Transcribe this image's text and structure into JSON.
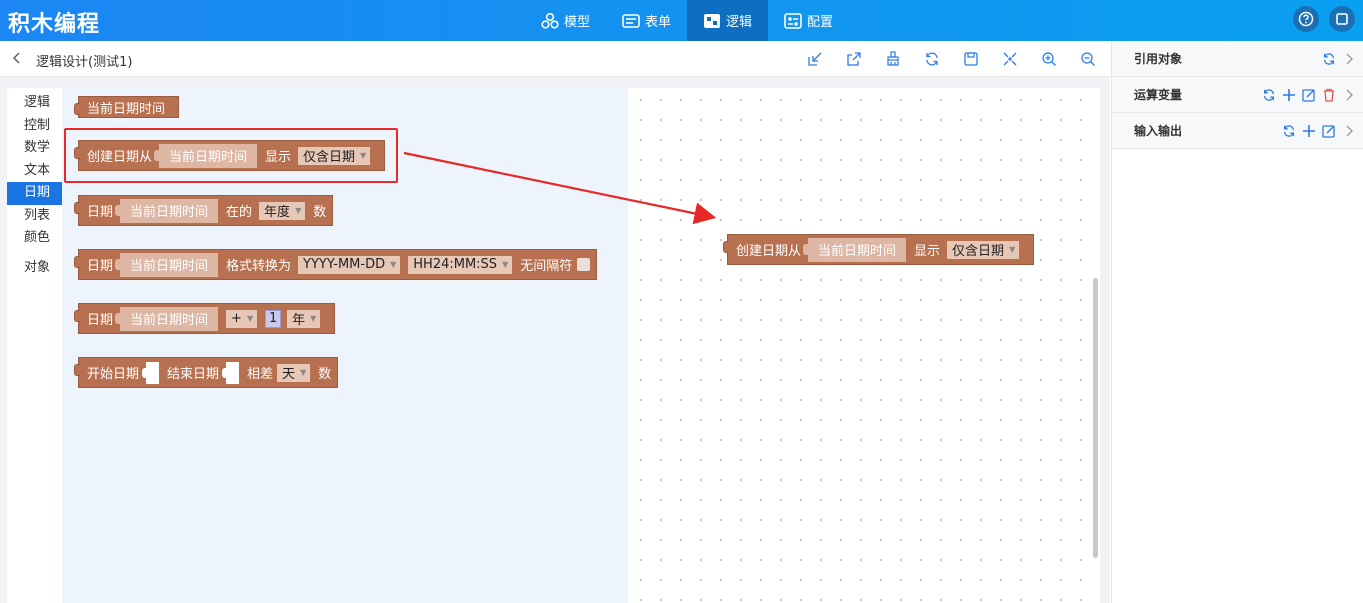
{
  "app": {
    "title": "积木编程"
  },
  "nav": [
    {
      "label": "模型",
      "icon": "cubes-icon",
      "active": false
    },
    {
      "label": "表单",
      "icon": "form-icon",
      "active": false
    },
    {
      "label": "逻辑",
      "icon": "logic-icon",
      "active": true
    },
    {
      "label": "配置",
      "icon": "config-icon",
      "active": false
    }
  ],
  "header_actions": [
    {
      "icon": "help-icon"
    },
    {
      "icon": "window-icon"
    }
  ],
  "subbar": {
    "title": "逻辑设计(测试1)"
  },
  "toolbar": [
    {
      "icon": "import-icon"
    },
    {
      "icon": "export-icon"
    },
    {
      "icon": "clean-icon"
    },
    {
      "icon": "refresh-icon"
    },
    {
      "icon": "save-icon"
    },
    {
      "icon": "center-icon"
    },
    {
      "icon": "zoom-in-icon"
    },
    {
      "icon": "zoom-out-icon"
    }
  ],
  "categories": [
    "逻辑",
    "控制",
    "数学",
    "文本",
    "日期",
    "列表",
    "颜色",
    "对象"
  ],
  "active_category": "日期",
  "blocks": {
    "b1": {
      "label": "当前日期时间"
    },
    "b2": {
      "label": "创建日期从",
      "inner": "当前日期时间",
      "show": "显示",
      "dd": "仅含日期"
    },
    "b3": {
      "label": "日期",
      "inner": "当前日期时间",
      "of": "在的",
      "dd": "年度",
      "tail": "数"
    },
    "b4": {
      "label": "日期",
      "inner": "当前日期时间",
      "fmt": "格式转换为",
      "dd1": "YYYY-MM-DD",
      "dd2": "HH24:MM:SS",
      "sep": "无间隔符"
    },
    "b5": {
      "label": "日期",
      "inner": "当前日期时间",
      "op": "+",
      "num": "1",
      "unit": "年"
    },
    "b6": {
      "label": "开始日期",
      "end": "结束日期",
      "diff": "相差",
      "dd": "天",
      "tail": "数"
    }
  },
  "canvas_block": {
    "label": "创建日期从",
    "inner": "当前日期时间",
    "show": "显示",
    "dd": "仅含日期"
  },
  "right_panel": [
    {
      "label": "引用对象",
      "icons": [
        "refresh-icon"
      ]
    },
    {
      "label": "运算变量",
      "icons": [
        "refresh-icon",
        "add-icon",
        "edit-icon",
        "delete-icon"
      ]
    },
    {
      "label": "输入输出",
      "icons": [
        "refresh-icon",
        "add-icon",
        "edit-icon"
      ]
    }
  ],
  "colors": {
    "brand": "#1c86f2",
    "block": "#b87150",
    "highlight": "#e62828",
    "active_category": "#1b74e4"
  }
}
